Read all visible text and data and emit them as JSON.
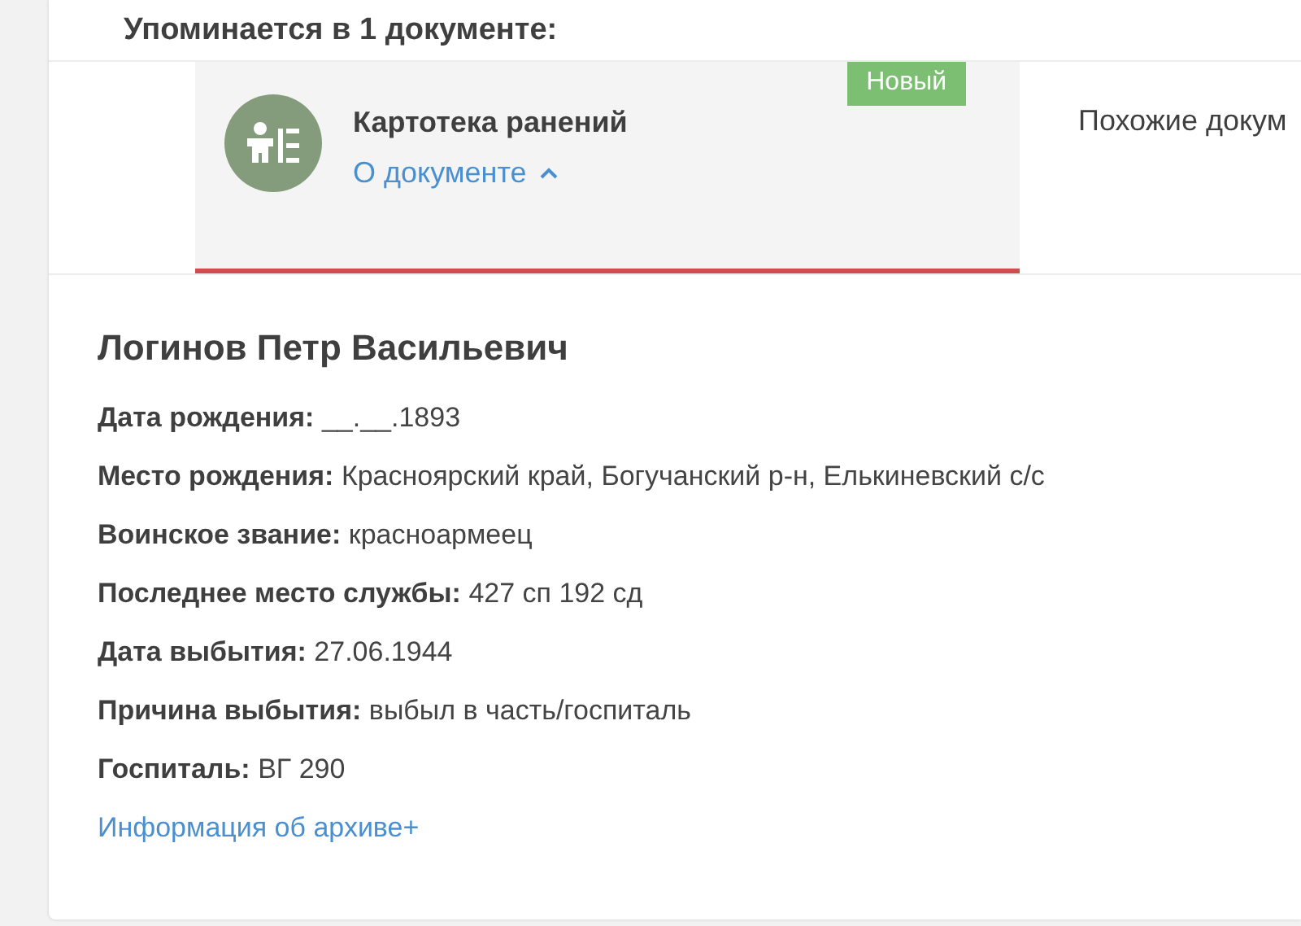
{
  "heading": "Упоминается в 1 документе:",
  "documents": [
    {
      "title": "Картотека ранений",
      "details_link": "О документе",
      "expanded": true,
      "badge": "Новый",
      "selected": true
    }
  ],
  "similar_tab": "Похожие докум",
  "person": {
    "name": "Логинов Петр Васильевич",
    "fields": [
      {
        "label": "Дата рождения:",
        "value": "__.__.1893"
      },
      {
        "label": "Место рождения:",
        "value": "Красноярский край, Богучанский р-н, Елькиневский с/с"
      },
      {
        "label": "Воинское звание:",
        "value": "красноармеец"
      },
      {
        "label": "Последнее место службы:",
        "value": "427 сп 192 сд"
      },
      {
        "label": "Дата выбытия:",
        "value": "27.06.1944"
      },
      {
        "label": "Причина выбытия:",
        "value": "выбыл в часть/госпиталь"
      },
      {
        "label": "Госпиталь:",
        "value": "ВГ 290"
      }
    ],
    "archive_link": "Информация об архиве+"
  }
}
